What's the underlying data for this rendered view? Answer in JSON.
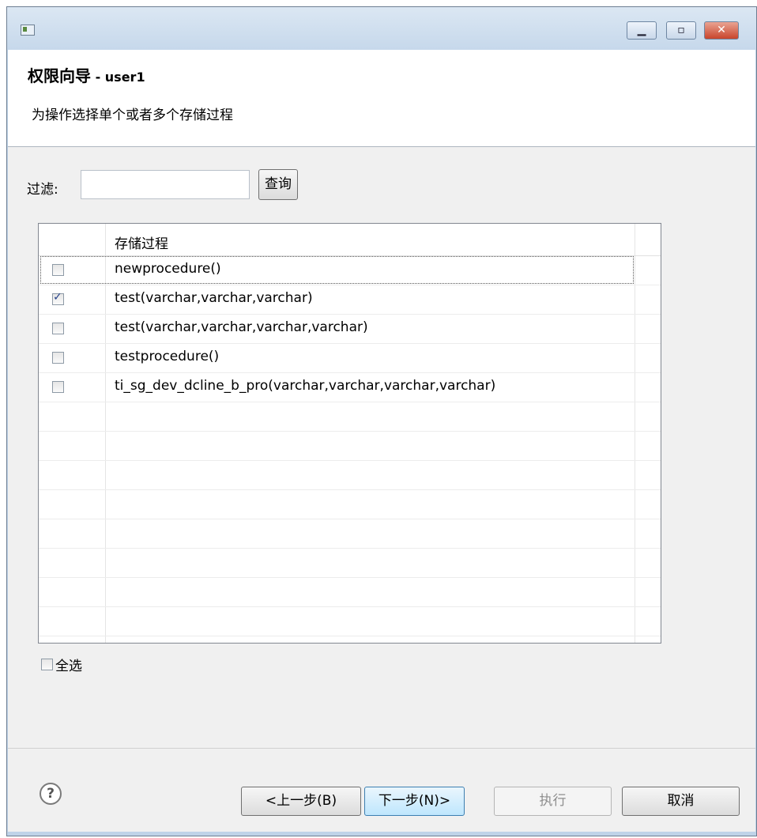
{
  "window": {
    "controls": {
      "minimize": "▁",
      "maximize": "▫",
      "close": "✕"
    }
  },
  "wizard": {
    "title": "权限向导",
    "subtitle": " - user1",
    "description": "为操作选择单个或者多个存储过程"
  },
  "filter": {
    "label": "过滤:",
    "value": "",
    "query_button": "查询"
  },
  "table": {
    "column_header": "存储过程",
    "rows": [
      {
        "name": "newprocedure()",
        "checked": false
      },
      {
        "name": "test(varchar,varchar,varchar)",
        "checked": true
      },
      {
        "name": "test(varchar,varchar,varchar,varchar)",
        "checked": false
      },
      {
        "name": "testprocedure()",
        "checked": false
      },
      {
        "name": "ti_sg_dev_dcline_b_pro(varchar,varchar,varchar,varchar)",
        "checked": false
      }
    ]
  },
  "select_all": {
    "label": "全选",
    "checked": false
  },
  "buttons": {
    "help": "?",
    "back": "<上一步(B)",
    "next": "下一步(N)>",
    "execute": "执行",
    "cancel": "取消"
  }
}
